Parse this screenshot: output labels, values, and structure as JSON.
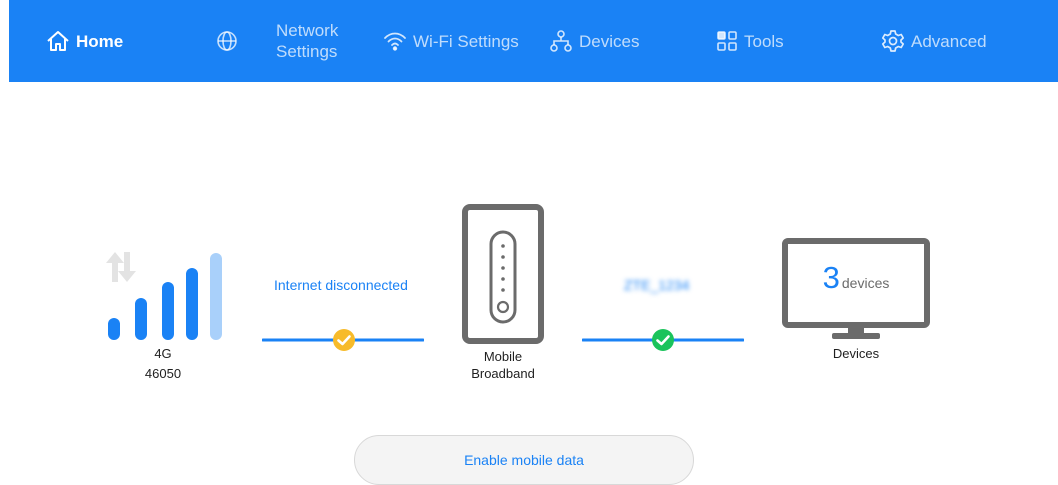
{
  "nav": {
    "home": "Home",
    "network_settings": "Network Settings",
    "wifi_settings": "Wi-Fi Settings",
    "devices": "Devices",
    "tools": "Tools",
    "advanced": "Advanced"
  },
  "signal": {
    "network_type": "4G",
    "operator_code": "46050"
  },
  "internet": {
    "status": "Internet disconnected"
  },
  "router": {
    "label": "Mobile Broadband"
  },
  "wifi": {
    "ssid_blurred": "ZTE_1234"
  },
  "devices_panel": {
    "count": "3",
    "unit": "devices",
    "label": "Devices"
  },
  "actions": {
    "enable_mobile_data": "Enable mobile data"
  },
  "colors": {
    "accent": "#1a82f5",
    "warning": "#f7bb2a",
    "success": "#1bc35b",
    "device_gray": "#6b6b6b"
  }
}
